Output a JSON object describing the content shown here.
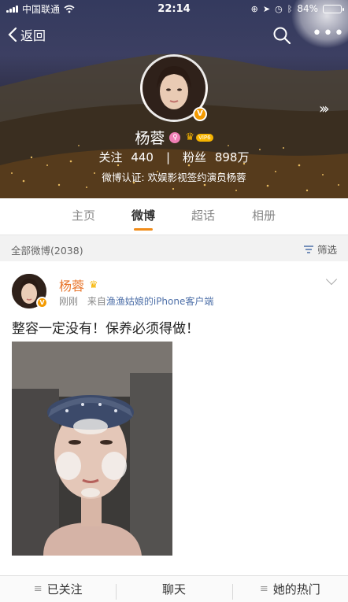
{
  "status_bar": {
    "carrier": "中国联通",
    "time": "22:14",
    "battery": "84%",
    "battery_level": 0.84
  },
  "nav": {
    "back_label": "返回"
  },
  "profile": {
    "name": "杨蓉",
    "vip_tag": "VIP6",
    "following_label": "关注",
    "following_count": "440",
    "divider": "|",
    "followers_label": "粉丝",
    "followers_count": "898万",
    "certification": "微博认证: 欢娱影视签约演员杨蓉"
  },
  "tabs": [
    {
      "label": "主页",
      "active": false
    },
    {
      "label": "微博",
      "active": true
    },
    {
      "label": "超话",
      "active": false
    },
    {
      "label": "相册",
      "active": false
    }
  ],
  "filter": {
    "count_text": "全部微博(2038)",
    "filter_label": "筛选"
  },
  "post": {
    "author": "杨蓉",
    "time": "刚刚",
    "source_prefix": "来自",
    "source": "渔渔姑娘的iPhone客户端",
    "text": "整容一定没有！保养必须得做！"
  },
  "bottom_bar": {
    "follow_label": "已关注",
    "chat_label": "聊天",
    "hot_label": "她的热门"
  },
  "colors": {
    "accent_orange": "#f08b18",
    "author_name": "#e8772e",
    "link_blue": "#4d6fa8",
    "verified_badge": "#f39a00"
  }
}
